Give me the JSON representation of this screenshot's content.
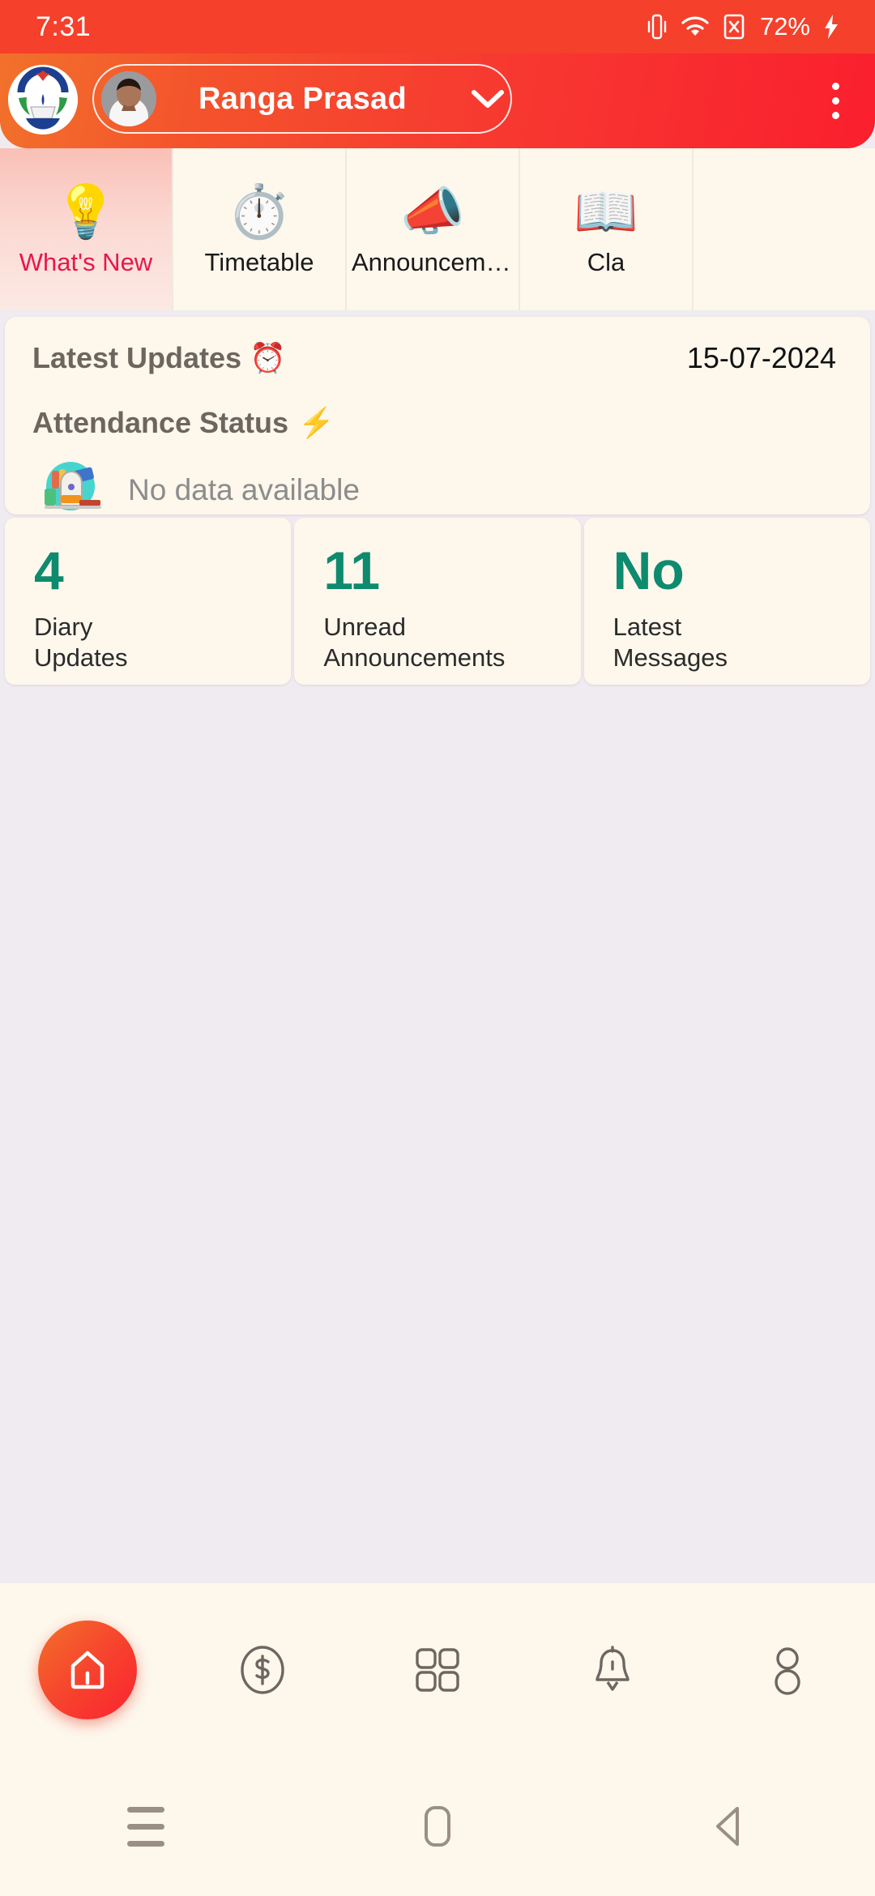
{
  "statusbar": {
    "time": "7:31",
    "battery": "72%",
    "icons": [
      "vibrate-icon",
      "wifi-icon",
      "sim-off-icon",
      "charging-bolt-icon"
    ]
  },
  "header": {
    "school_logo_alt": "school-crest-logo",
    "student_name": "Ranga Prasad",
    "avatar_alt": "student-avatar",
    "dropdown_icon": "chevron-down-icon",
    "overflow_icon": "kebab-menu-icon",
    "gradient_start": "#F2712B",
    "gradient_end": "#FA1F2E"
  },
  "tabs": {
    "active_index": 0,
    "active_color": "#E8174A",
    "items": [
      {
        "label": "What's New",
        "emoji": "💡",
        "icon": "lightbulb-book-icon"
      },
      {
        "label": "Timetable",
        "emoji": "⏱️",
        "icon": "clock-gear-icon"
      },
      {
        "label": "Announcemen…",
        "emoji": "📣",
        "icon": "megaphone-icon"
      },
      {
        "label": "Cla",
        "emoji": "📖",
        "icon": "open-book-icon"
      }
    ]
  },
  "latest_updates": {
    "title": "Latest Updates",
    "title_emoji": "⏰",
    "date": "15-07-2024",
    "attendance_title": "Attendance Status",
    "attendance_emoji": "⚡",
    "empty_text": "No data available",
    "empty_illustration": "school-bag-empty-icon"
  },
  "stats": [
    {
      "value": "4",
      "label": "Diary\nUpdates",
      "label_line1": "Diary",
      "label_line2": "Updates"
    },
    {
      "value": "11",
      "label": "Unread Announcements",
      "label_line1": "Unread",
      "label_line2": "Announcements"
    },
    {
      "value": "No",
      "label": "Latest Messages",
      "label_line1": "Latest",
      "label_line2": "Messages"
    }
  ],
  "stats_value_color": "#0E8A6E",
  "bottom_nav": {
    "active_index": 0,
    "items": [
      {
        "icon": "home-icon",
        "name": "home"
      },
      {
        "icon": "dollar-circle-icon",
        "name": "fees"
      },
      {
        "icon": "grid-apps-icon",
        "name": "apps"
      },
      {
        "icon": "bell-icon",
        "name": "notifications"
      },
      {
        "icon": "person-icon",
        "name": "profile"
      }
    ]
  },
  "system_nav": {
    "items": [
      {
        "icon": "recents-icon"
      },
      {
        "icon": "home-square-icon"
      },
      {
        "icon": "back-triangle-icon"
      }
    ]
  }
}
